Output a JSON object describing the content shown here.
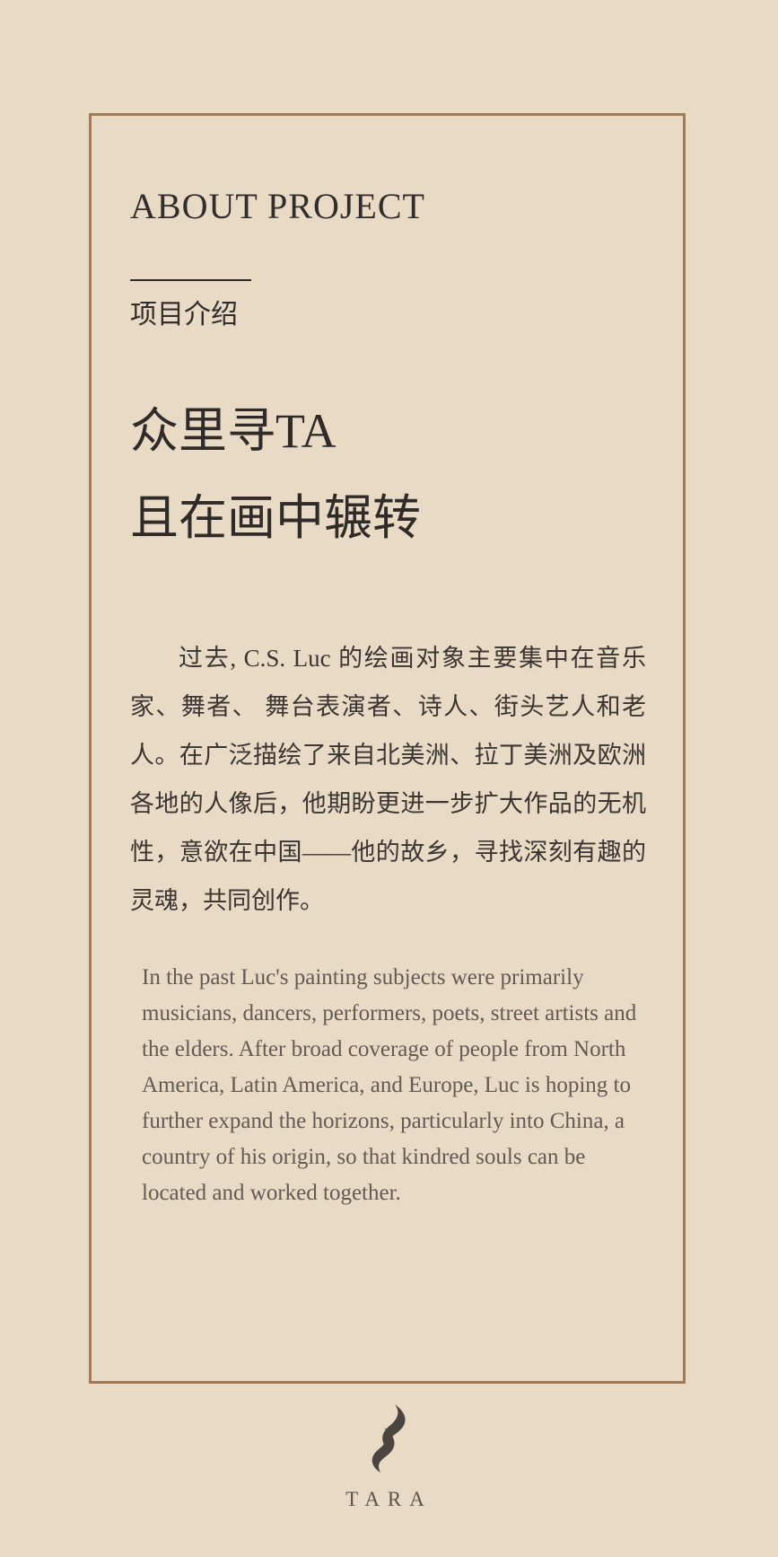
{
  "section": {
    "title": "ABOUT  PROJECT",
    "subtitle": "项目介绍"
  },
  "headline": {
    "line1": "众里寻TA",
    "line2": "且在画中辗转"
  },
  "body": {
    "chinese": "过去, C.S. Luc 的绘画对象主要集中在音乐家、舞者、 舞台表演者、诗人、街头艺人和老人。在广泛描绘了来自北美洲、拉丁美洲及欧洲各地的人像后，他期盼更进一步扩大作品的无机性，意欲在中国——他的故乡，寻找深刻有趣的灵魂，共同创作。",
    "english": "In the past Luc's painting subjects were primarily musicians, dancers, performers, poets, street artists and the elders.   After broad coverage of people from North America, Latin America, and Europe, Luc is hoping to further expand the horizons, particularly into China, a country of his origin, so that kindred souls can be located and worked together."
  },
  "brand": {
    "name": "TARA",
    "logo_icon": "flame-swirl-logo-icon"
  },
  "colors": {
    "background": "#e9dac6",
    "frame_border": "#a37a57",
    "text_primary": "#312d2a",
    "text_secondary": "#635a53"
  }
}
